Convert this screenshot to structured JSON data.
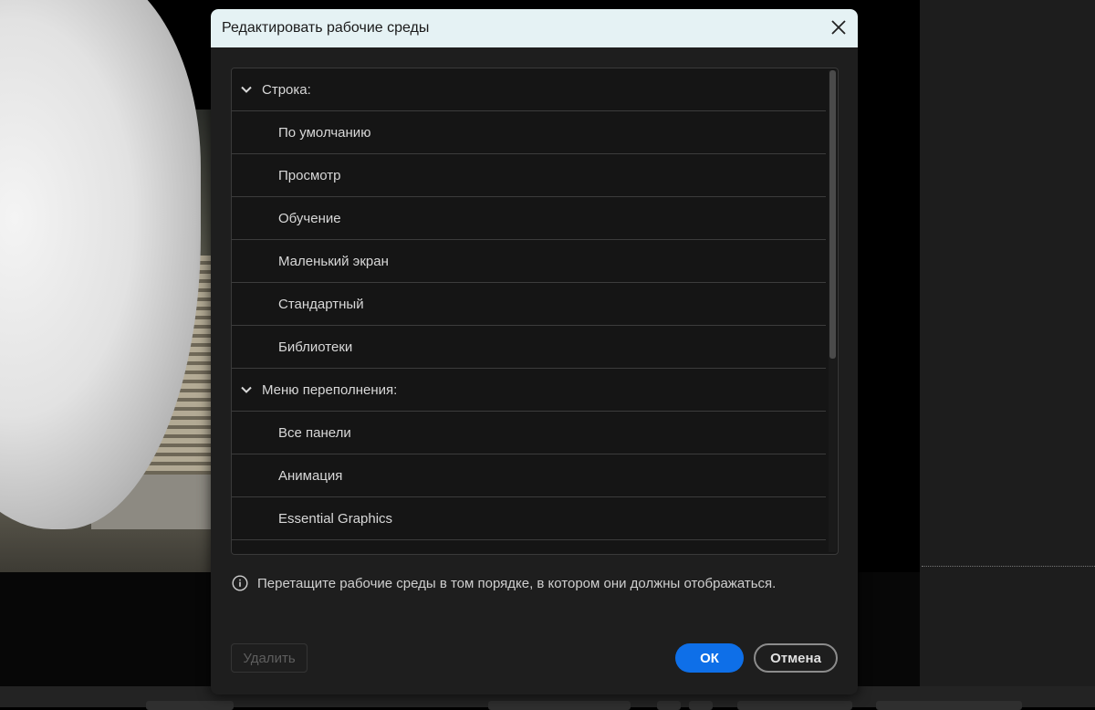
{
  "dialog": {
    "title": "Редактировать рабочие среды",
    "close_icon": "close-icon"
  },
  "workspaces": {
    "groups": [
      {
        "label": "Строка:",
        "items": [
          "По умолчанию",
          "Просмотр",
          "Обучение",
          "Маленький экран",
          "Стандартный",
          "Библиотеки"
        ]
      },
      {
        "label": "Меню переполнения:",
        "items": [
          "Все панели",
          "Анимация",
          "Essential Graphics"
        ]
      }
    ]
  },
  "hint": {
    "icon": "info-icon",
    "text": "Перетащите рабочие среды в том порядке, в котором они должны отображаться."
  },
  "buttons": {
    "delete": "Удалить",
    "ok": "ОК",
    "cancel": "Отмена"
  },
  "colors": {
    "header_bg": "#e5f2f4",
    "dialog_bg": "#1e1e1e",
    "primary": "#0e6fe8"
  }
}
